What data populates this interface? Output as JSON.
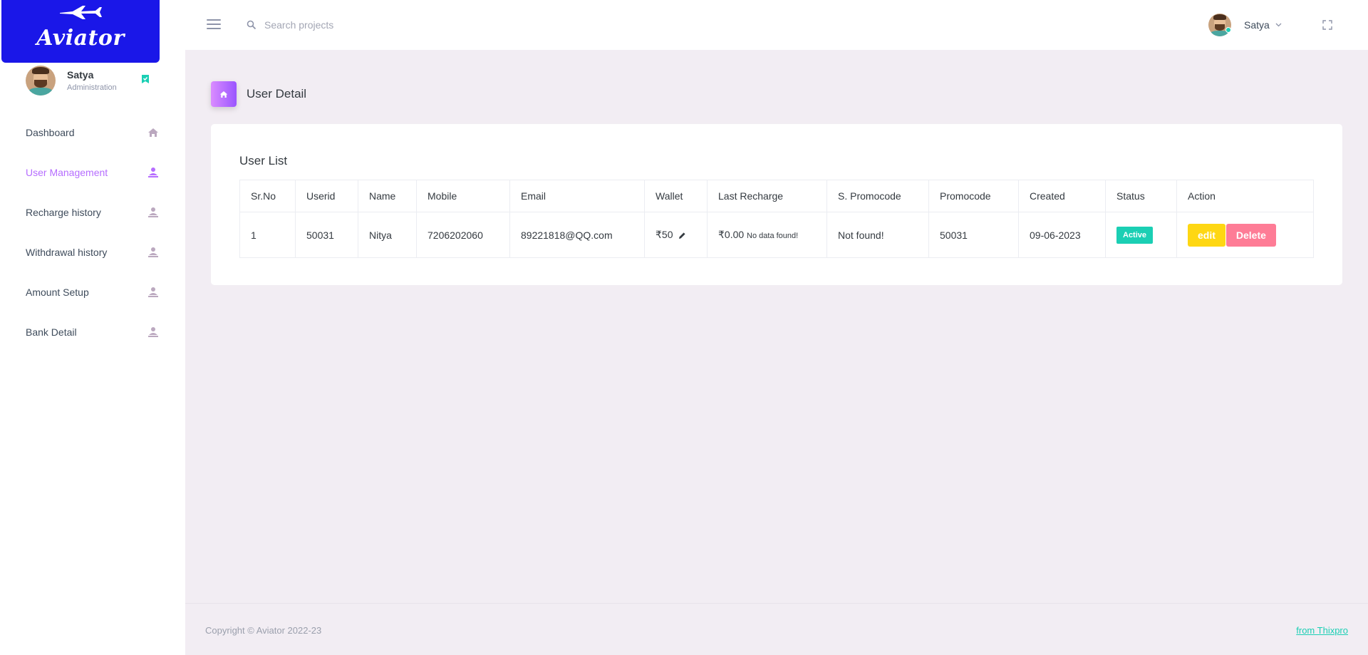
{
  "brand": {
    "name": "Aviator"
  },
  "sidebar": {
    "profile": {
      "name": "Satya",
      "role": "Administration"
    },
    "items": [
      {
        "label": "Dashboard",
        "icon": "home-icon"
      },
      {
        "label": "User Management",
        "icon": "user-icon",
        "active": true
      },
      {
        "label": "Recharge history",
        "icon": "user-icon"
      },
      {
        "label": "Withdrawal history",
        "icon": "user-icon"
      },
      {
        "label": "Amount Setup",
        "icon": "user-icon"
      },
      {
        "label": "Bank Detail",
        "icon": "user-icon"
      }
    ]
  },
  "topbar": {
    "search_placeholder": "Search projects",
    "user_name": "Satya"
  },
  "page": {
    "title": "User Detail",
    "card_title": "User List"
  },
  "table": {
    "headers": [
      "Sr.No",
      "Userid",
      "Name",
      "Mobile",
      "Email",
      "Wallet",
      "Last Recharge",
      "S. Promocode",
      "Promocode",
      "Created",
      "Status",
      "Action"
    ],
    "rows": [
      {
        "sr_no": "1",
        "userid": "50031",
        "name": "Nitya",
        "mobile": "7206202060",
        "email": "89221818@QQ.com",
        "wallet": "₹50",
        "last_recharge": "₹0.00",
        "last_recharge_note": "No data found!",
        "s_promocode": "Not found!",
        "promocode": "50031",
        "created": "09-06-2023",
        "status": "Active",
        "edit_label": "edit",
        "delete_label": "Delete"
      }
    ]
  },
  "footer": {
    "copyright": "Copyright © Aviator 2022-23",
    "credit": "from Thixpro"
  },
  "colors": {
    "brand_blue": "#1a17e8",
    "accent_purple": "#b66dff",
    "status_green": "#1bcfb4",
    "edit_yellow": "#fed713",
    "delete_pink": "#fe7c96"
  }
}
